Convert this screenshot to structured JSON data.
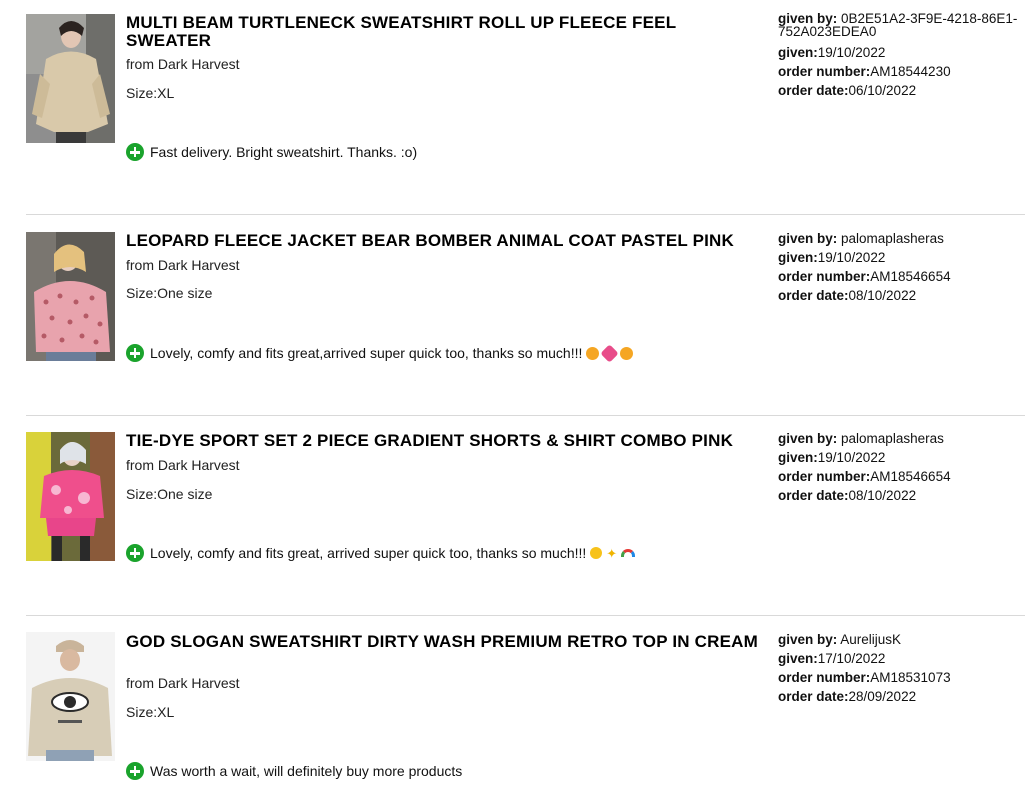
{
  "reviews": [
    {
      "title": "MULTI BEAM TURTLENECK SWEATSHIRT ROLL UP FLEECE FEEL SWEATER",
      "from": "from Dark Harvest",
      "size_label": "Size:",
      "size": "XL",
      "comment": "Fast delivery. Bright sweatshirt. Thanks. :o)",
      "given_by_label": "given by:",
      "given_by": "0B2E51A2-3F9E-4218-86E1-752A023EDEA0",
      "given_label": "given:",
      "given": "19/10/2022",
      "order_number_label": "order number:",
      "order_number": "AM18544230",
      "order_date_label": "order date:",
      "order_date": "06/10/2022"
    },
    {
      "title": "LEOPARD FLEECE JACKET BEAR BOMBER ANIMAL COAT PASTEL PINK",
      "from": "from Dark Harvest",
      "size_label": "Size:",
      "size": "One size",
      "comment": "Lovely, comfy and fits great,arrived super quick too, thanks so much!!!",
      "given_by_label": "given by:",
      "given_by": "palomaplasheras",
      "given_label": "given:",
      "given": "19/10/2022",
      "order_number_label": "order number:",
      "order_number": "AM18546654",
      "order_date_label": "order date:",
      "order_date": "08/10/2022"
    },
    {
      "title": "TIE-DYE SPORT SET 2 PIECE GRADIENT SHORTS & SHIRT COMBO PINK",
      "from": "from Dark Harvest",
      "size_label": "Size:",
      "size": "One size",
      "comment": "Lovely, comfy and fits great, arrived super quick too, thanks so much!!!",
      "given_by_label": "given by:",
      "given_by": "palomaplasheras",
      "given_label": "given:",
      "given": "19/10/2022",
      "order_number_label": "order number:",
      "order_number": "AM18546654",
      "order_date_label": "order date:",
      "order_date": "08/10/2022"
    },
    {
      "title": "GOD SLOGAN SWEATSHIRT DIRTY WASH PREMIUM RETRO TOP IN CREAM",
      "from": "from Dark Harvest",
      "size_label": "Size:",
      "size": "XL",
      "comment": "Was worth a wait, will definitely buy more products",
      "given_by_label": "given by:",
      "given_by": "AurelijusK",
      "given_label": "given:",
      "given": "17/10/2022",
      "order_number_label": "order number:",
      "order_number": "AM18531073",
      "order_date_label": "order date:",
      "order_date": "28/09/2022"
    }
  ],
  "colors": {
    "positive_icon": "#1aa32c",
    "divider": "#d9d9d9"
  },
  "icons": {
    "comment": "plus-circle-icon"
  }
}
